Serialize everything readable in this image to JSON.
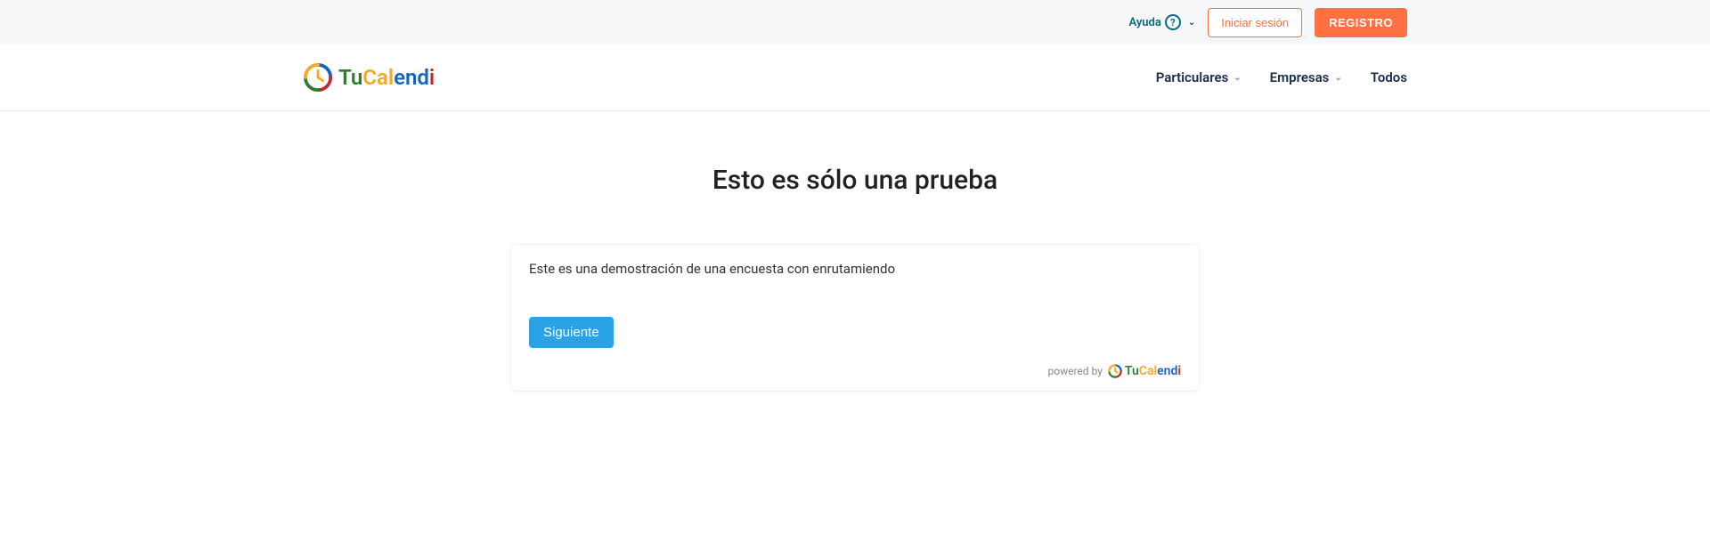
{
  "topbar": {
    "help_label": "Ayuda",
    "login_label": "Iniciar sesión",
    "register_label": "REGISTRO"
  },
  "logo": {
    "part_tu": "Tu",
    "part_cal": "Cal",
    "part_end": "end",
    "part_i": "i"
  },
  "nav": {
    "item1": "Particulares",
    "item2": "Empresas",
    "item3": "Todos"
  },
  "main": {
    "title": "Esto es sólo una prueba",
    "description": "Este es una demostración de una encuesta con enrutamiendo",
    "next_label": "Siguiente"
  },
  "footer": {
    "powered_by": "powered by",
    "brand_tu": "Tu",
    "brand_cal": "Cal",
    "brand_end": "end",
    "brand_i": "i"
  }
}
